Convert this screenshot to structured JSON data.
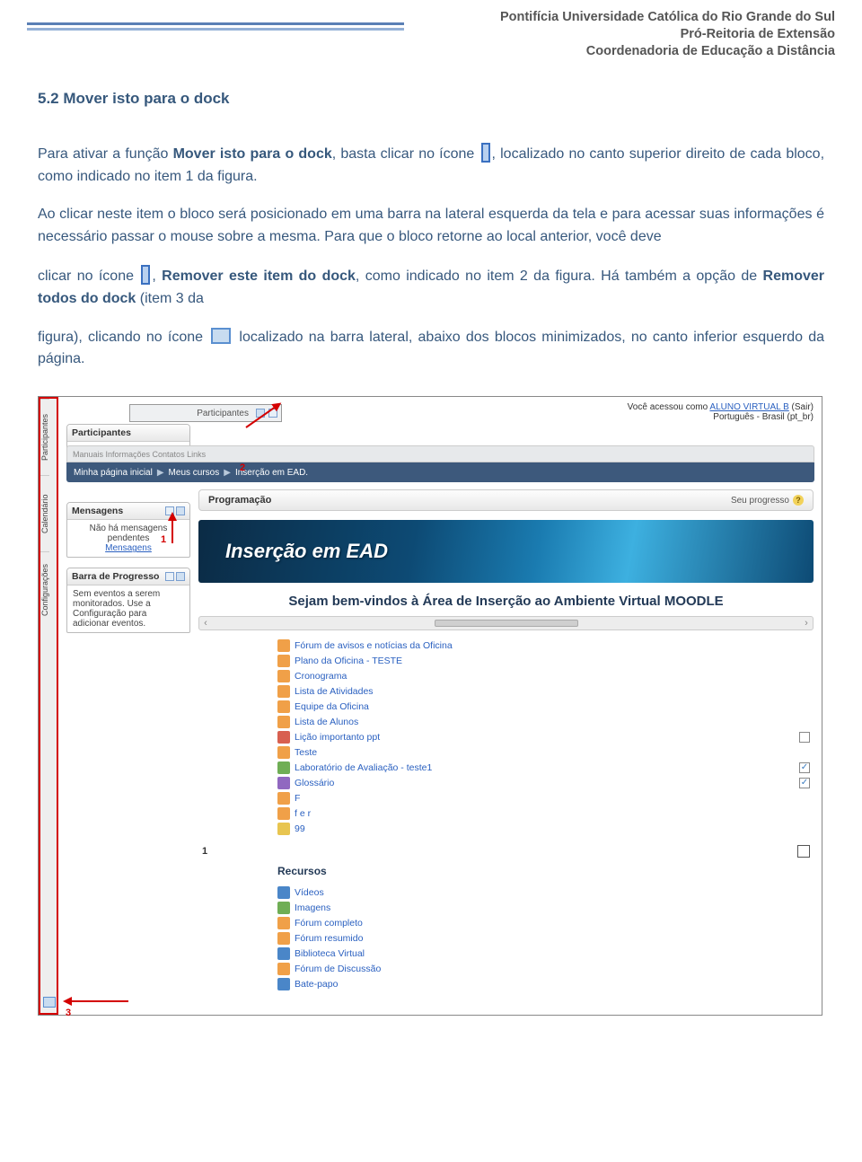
{
  "header": {
    "line1": "Pontifícia Universidade Católica do Rio Grande do Sul",
    "line2": "Pró-Reitoria de Extensão",
    "line3": "Coordenadoria de Educação a Distância"
  },
  "section_title": "5.2 Mover isto para o dock",
  "p1_a": "Para ativar a função ",
  "p1_func": "Mover isto para o dock",
  "p1_b": ", basta clicar no ícone ",
  "p1_c": ", localizado no canto superior direito de cada bloco, como indicado no item 1 da figura.",
  "p2": "Ao clicar neste item o bloco será posicionado em uma barra na lateral esquerda da tela e para acessar suas informações é necessário passar o mouse sobre a mesma. Para que o bloco retorne ao local anterior, você deve",
  "p3_a": "clicar no ícone ",
  "p3_func1": "Remover este item do dock",
  "p3_b": ", como indicado no item 2 da figura. Há também a opção de ",
  "p3_func2": "Remover todos do dock",
  "p3_c": " (item 3 da",
  "p4_a": "figura), clicando no ícone ",
  "p4_b": " localizado na barra lateral, abaixo dos blocos minimizados, no canto inferior esquerdo da página.",
  "p3_sep": ", ",
  "figure": {
    "dock_items": [
      "Participantes",
      "Calendário",
      "Configurações"
    ],
    "tooltip_label": "Participantes",
    "top_right_logged": "Você acessou como ",
    "top_right_user": "ALUNO VIRTUAL B",
    "top_right_exit": " (Sair)",
    "top_right_lang": "Português - Brasil (pt_br)",
    "block_participantes_title": "Participantes",
    "block_participantes_link": "Participantes",
    "nav_tabs": "Manuais    Informações    Contatos    Links",
    "breadcrumb": {
      "a": "Minha página inicial",
      "b": "Meus cursos",
      "c": "Inserção em EAD."
    },
    "block_msg_title": "Mensagens",
    "block_msg_body1": "Não há mensagens pendentes",
    "block_msg_link": "Mensagens",
    "block_prog_title": "Barra de Progresso",
    "block_prog_body": "Sem eventos a serem monitorados. Use a Configuração para adicionar eventos.",
    "callouts": {
      "c1": "1",
      "c2": "2",
      "c3": "3"
    },
    "prog_header_left": "Programação",
    "prog_header_right": "Seu progresso",
    "banner_title": "Inserção em EAD",
    "welcome": "Sejam bem-vindos à Área de Inserção ao Ambiente Virtual MOODLE",
    "resources": [
      {
        "icon": "or",
        "label": "Fórum de avisos e notícias da Oficina"
      },
      {
        "icon": "or",
        "label": "Plano da Oficina - TESTE"
      },
      {
        "icon": "or",
        "label": "Cronograma"
      },
      {
        "icon": "or",
        "label": "Lista de Atividades"
      },
      {
        "icon": "or",
        "label": "Equipe da Oficina"
      },
      {
        "icon": "or",
        "label": "Lista de Alunos"
      },
      {
        "icon": "rd",
        "label": "Lição importanto ppt",
        "chk": true,
        "done": false
      },
      {
        "icon": "or",
        "label": "Teste"
      },
      {
        "icon": "gr",
        "label": "Laboratório de Avaliação - teste1",
        "chk": true,
        "done": true
      },
      {
        "icon": "pu",
        "label": "Glossário",
        "chk": true,
        "done": true
      },
      {
        "icon": "or",
        "label": "F"
      },
      {
        "icon": "or",
        "label": "f e r"
      },
      {
        "icon": "ye",
        "label": "99"
      }
    ],
    "section_num": "1",
    "recursos_title": "Recursos",
    "recursos": [
      {
        "icon": "bl",
        "label": "Vídeos"
      },
      {
        "icon": "gr",
        "label": "Imagens"
      },
      {
        "icon": "or",
        "label": "Fórum completo"
      },
      {
        "icon": "or",
        "label": "Fórum resumido"
      },
      {
        "icon": "bl",
        "label": "Biblioteca Virtual"
      },
      {
        "icon": "or",
        "label": "Fórum de Discussão"
      },
      {
        "icon": "bl",
        "label": "Bate-papo"
      }
    ]
  }
}
